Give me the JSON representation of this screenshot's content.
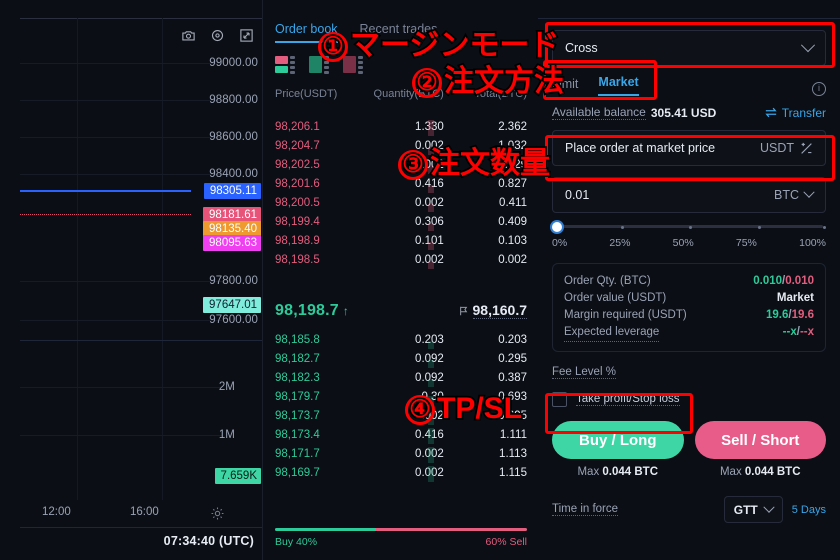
{
  "chart": {
    "toolbar_icons": [
      "camera-icon",
      "crosshair-icon",
      "fullscreen-icon"
    ],
    "y_labels": [
      "99000.00",
      "98800.00",
      "98600.00",
      "98400.00",
      "97800.00",
      "97600.00",
      "2M",
      "1M"
    ],
    "price_tags": [
      {
        "value": "98305.11",
        "color": "#2962ff",
        "text": "#ffffff"
      },
      {
        "value": "98181.61",
        "color": "#e8537a",
        "text": "#ffffff"
      },
      {
        "value": "98135.40",
        "color": "#ee9a2e",
        "text": "#ffffff"
      },
      {
        "value": "98095.63",
        "color": "#ef3ff0",
        "text": "#ffffff"
      },
      {
        "value": "97647.01",
        "color": "#7fecdc",
        "text": "#102030"
      },
      {
        "value": "7.659K",
        "color": "#3ed6a5",
        "text": "#0b1f18"
      }
    ],
    "x_labels": [
      "12:00",
      "16:00"
    ],
    "clock": "07:34:40 (UTC)"
  },
  "orderbook": {
    "tabs": [
      {
        "label": "Order book",
        "active": true
      },
      {
        "label": "Recent trades",
        "active": false
      }
    ],
    "columns": [
      "Price(USDT)",
      "Quantity(BTC)",
      "Total(BTC)"
    ],
    "asks": [
      {
        "price": "98,206.1",
        "qty": "1.330",
        "total": "2.362",
        "depth": 100
      },
      {
        "price": "98,204.7",
        "qty": "0.002",
        "total": "1.032",
        "depth": 44
      },
      {
        "price": "98,202.5",
        "qty": "0.002",
        "total": "0.829",
        "depth": 35
      },
      {
        "price": "98,201.6",
        "qty": "0.416",
        "total": "0.827",
        "depth": 35
      },
      {
        "price": "98,200.5",
        "qty": "0.002",
        "total": "0.411",
        "depth": 17
      },
      {
        "price": "98,199.4",
        "qty": "0.306",
        "total": "0.409",
        "depth": 17
      },
      {
        "price": "98,198.9",
        "qty": "0.101",
        "total": "0.103",
        "depth": 5
      },
      {
        "price": "98,198.5",
        "qty": "0.002",
        "total": "0.002",
        "depth": 2
      }
    ],
    "mid": {
      "last_price": "98,198.7",
      "direction": "↑",
      "mark_price": "98,160.7"
    },
    "bids": [
      {
        "price": "98,185.8",
        "qty": "0.203",
        "total": "0.203",
        "depth": 18
      },
      {
        "price": "98,182.7",
        "qty": "0.092",
        "total": "0.295",
        "depth": 26
      },
      {
        "price": "98,182.3",
        "qty": "0.092",
        "total": "0.387",
        "depth": 34
      },
      {
        "price": "98,179.7",
        "qty": "0.30",
        "total": "0.693",
        "depth": 60
      },
      {
        "price": "98,173.7",
        "qty": "0.002",
        "total": "0.695",
        "depth": 61
      },
      {
        "price": "98,173.4",
        "qty": "0.416",
        "total": "1.111",
        "depth": 97
      },
      {
        "price": "98,171.7",
        "qty": "0.002",
        "total": "1.113",
        "depth": 98
      },
      {
        "price": "98,169.7",
        "qty": "0.002",
        "total": "1.115",
        "depth": 100
      }
    ],
    "ratio": {
      "buy_label": "Buy 40%",
      "sell_label": "60% Sell",
      "buy_pct": 40,
      "sell_pct": 60
    }
  },
  "form": {
    "margin_mode": "Cross",
    "order_type_tabs": [
      {
        "label": "Limit",
        "active": false
      },
      {
        "label": "Market",
        "active": true
      }
    ],
    "available_balance_label": "Available balance",
    "available_balance_value": "305.41 USD",
    "transfer_label": "Transfer",
    "price_field": {
      "text": "Place order at market price",
      "unit": "USDT"
    },
    "qty_field": {
      "value": "0.01",
      "unit": "BTC"
    },
    "slider_ticks": [
      "0%",
      "25%",
      "50%",
      "75%",
      "100%"
    ],
    "summary": [
      {
        "key": "Order Qty. (BTC)",
        "buy": "0.010",
        "sep": "/",
        "sell": "0.010",
        "dotted": false
      },
      {
        "key": "Order value (USDT)",
        "value": "Market",
        "dotted": false
      },
      {
        "key": "Margin required (USDT)",
        "buy": "19.6",
        "sep": "/",
        "sell": "19.6",
        "dotted": false
      },
      {
        "key": "Expected leverage",
        "buy": "--x",
        "sep": "/",
        "sell": "--x",
        "dotted": true
      }
    ],
    "fee_level": "Fee Level %",
    "tpsl_label": "Take profit/Stop loss",
    "buy_button": "Buy / Long",
    "sell_button": "Sell / Short",
    "buy_max_label": "Max",
    "buy_max_value": "0.044 BTC",
    "sell_max_label": "Max",
    "sell_max_value": "0.044 BTC",
    "time_in_force_label": "Time in force",
    "time_in_force_value": "GTT",
    "time_in_force_days": "5 Days"
  },
  "annotations": [
    {
      "id": "a1",
      "num": "①",
      "text": "マージンモード"
    },
    {
      "id": "a2",
      "num": "②",
      "text": "注文方法"
    },
    {
      "id": "a3",
      "num": "③",
      "text": "注文数量"
    },
    {
      "id": "a4",
      "num": "④",
      "text": "TP/SL"
    }
  ]
}
